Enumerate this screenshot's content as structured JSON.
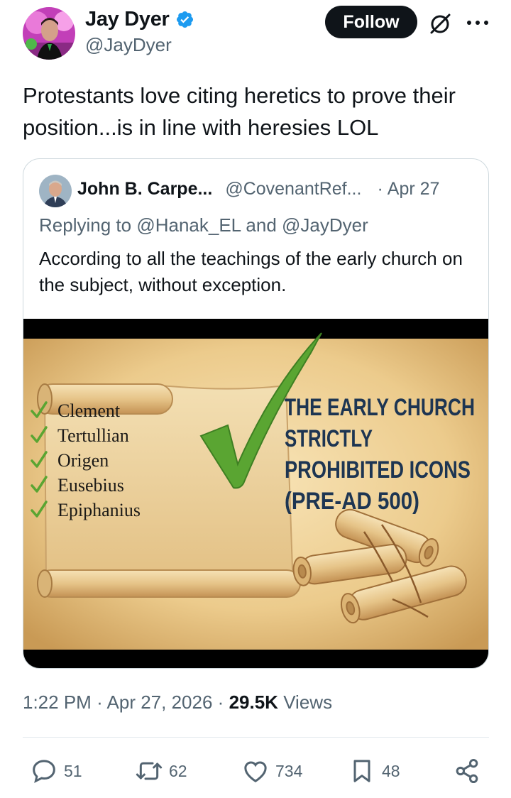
{
  "author": {
    "display_name": "Jay Dyer",
    "handle": "@JayDyer",
    "verified": true
  },
  "follow_label": "Follow",
  "tweet_text": "Protestants love citing heretics to prove their position...is in line with heresies LOL",
  "quoted": {
    "display_name": "John B. Carpe...",
    "handle": "@CovenantRef...",
    "dot": "·",
    "date": "Apr 27",
    "replying_prefix": "Replying to",
    "replying_user1": "@Hanak_EL",
    "replying_and": "and",
    "replying_user2": "@JayDyer",
    "text": "According to all the teachings of the early church on the subject, without exception.",
    "image": {
      "names": [
        "Clement",
        "Tertullian",
        "Origen",
        "Eusebius",
        "Epiphanius"
      ],
      "headline_lines": [
        "THE EARLY CHURCH",
        "STRICTLY",
        "PROHIBITED ICONS",
        "(PRE-AD 500)"
      ]
    }
  },
  "meta": {
    "time": "1:22 PM",
    "sep1": "·",
    "date": "Apr 27, 2026",
    "sep2": "·",
    "views_count": "29.5K",
    "views_label": "Views"
  },
  "actions": {
    "replies": "51",
    "reposts": "62",
    "likes": "734",
    "bookmarks": "48"
  },
  "colors": {
    "accent_verified": "#1d9bf0",
    "text_primary": "#0f1419",
    "text_secondary": "#536471",
    "check_green": "#5aa532"
  }
}
